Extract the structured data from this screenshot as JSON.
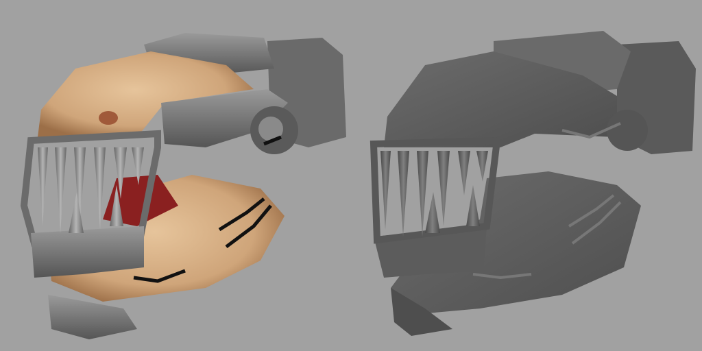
{
  "colors": {
    "background": "#a1a1a1",
    "flesh": "#d9b48a",
    "flesh_dark": "#a87c55",
    "metal": "#7a7a7a",
    "metal_dark": "#4a4a4a",
    "untextured": "#5e5e5e",
    "untextured_light": "#6e6e6e",
    "mouth": "#8a2020"
  }
}
